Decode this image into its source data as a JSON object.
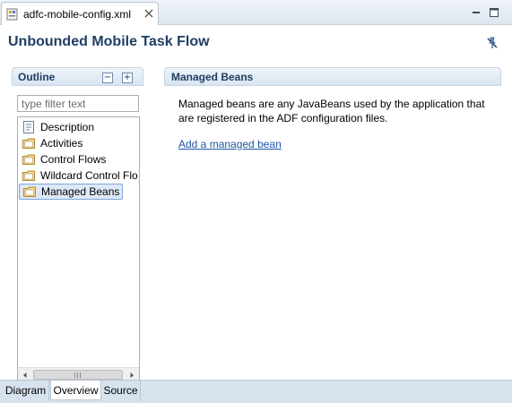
{
  "editor_tab": {
    "label": "adfc-mobile-config.xml",
    "icon": "xml-file-icon"
  },
  "window_controls": {
    "minimize_icon": "minimize-icon",
    "maximize_icon": "maximize-icon"
  },
  "page": {
    "title": "Unbounded Mobile Task Flow",
    "tool_icon": "pin-icon"
  },
  "outline": {
    "title": "Outline",
    "filter_placeholder": "type filter text",
    "items": [
      {
        "label": "Description",
        "icon": "page-icon"
      },
      {
        "label": "Activities",
        "icon": "folder-icon"
      },
      {
        "label": "Control Flows",
        "icon": "folder-icon"
      },
      {
        "label": "Wildcard Control Flo",
        "icon": "folder-icon"
      },
      {
        "label": "Managed Beans",
        "icon": "folder-icon",
        "selected": true
      }
    ]
  },
  "details": {
    "title": "Managed Beans",
    "description": "Managed beans are any JavaBeans used by the application that are registered in the ADF configuration files.",
    "link": "Add a managed bean"
  },
  "bottom_tabs": {
    "diagram": "Diagram",
    "overview": "Overview",
    "source": "Source",
    "active": "Overview"
  },
  "colors": {
    "title": "#1f3f63",
    "link": "#1f55a5",
    "header_bg": "#d9e5f1",
    "selection": "#dde9f7"
  }
}
